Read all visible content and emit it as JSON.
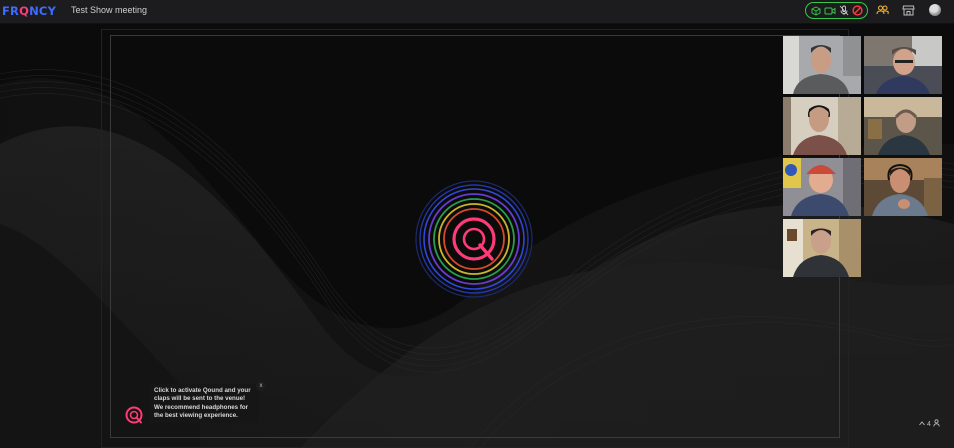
{
  "app": {
    "logo": {
      "part1": "FR",
      "part2": "Q",
      "part3": "NCY"
    },
    "meeting_title": "Test Show meeting"
  },
  "controls": {
    "icons": [
      "cube-icon",
      "camera-icon",
      "mic-muted-icon",
      "no-entry-icon"
    ],
    "accent": "#38c94a",
    "danger": "#ff3b3b"
  },
  "topbar_icons": [
    "people-icon",
    "storefront-icon",
    "avatar"
  ],
  "venue": {
    "center_logo": "qound-logo"
  },
  "participants": [
    {
      "name": "participant-1"
    },
    {
      "name": "participant-2"
    },
    {
      "name": "participant-3"
    },
    {
      "name": "participant-4"
    },
    {
      "name": "participant-5"
    },
    {
      "name": "participant-6"
    },
    {
      "name": "participant-7"
    }
  ],
  "notice": {
    "text": "Click to activate Qound and your claps will be sent to the venue! We recommend headphones for the best viewing experience.",
    "close": "x"
  },
  "viewer_count": "4"
}
